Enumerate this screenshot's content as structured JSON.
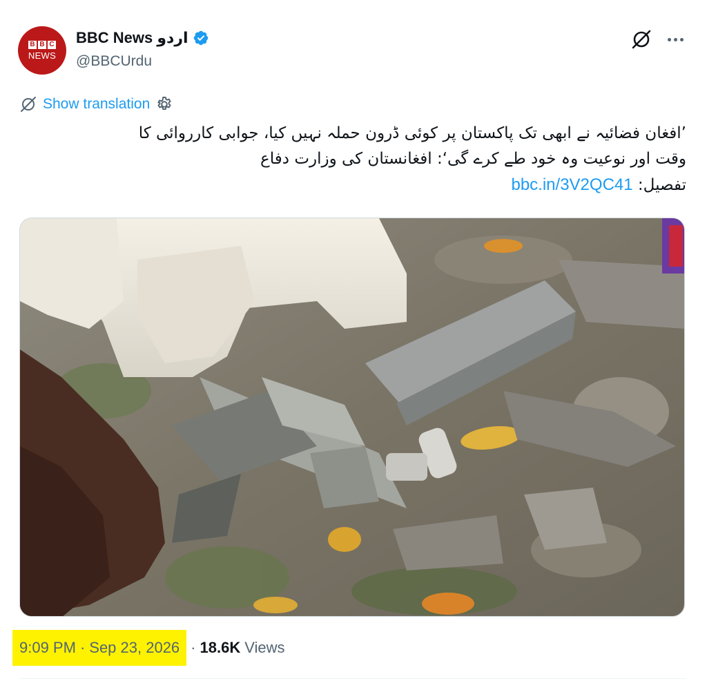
{
  "account": {
    "display_name": "BBC News اردو",
    "handle": "@BBCUrdu",
    "verified": true,
    "avatar": {
      "letters": [
        "B",
        "B",
        "C"
      ],
      "word": "NEWS",
      "color": "#bb1919"
    }
  },
  "actions": {
    "grok_icon": "grok-slash-icon",
    "more_icon": "more-dots-icon"
  },
  "translation": {
    "label": "Show translation"
  },
  "tweet": {
    "line1": "’افغان فضائیہ نے ابھی تک پاکستان پر کوئی ڈرون حملہ نہیں کیا، جوابی کارروائی کا",
    "line2": "وقت اور نوعیت وہ خود طے کرے گی‘: افغانستان کی وزارت دفاع",
    "line3_prefix": "تفصیل: ",
    "link": "bbc.in/3V2QC41"
  },
  "media": {
    "alt": "drone wreckage photo"
  },
  "meta": {
    "time": "9:09 PM",
    "separator": "·",
    "date": "Sep 23, 2026",
    "views_count": "18.6K",
    "views_label": "Views",
    "highlight_color": "#fff200"
  },
  "colors": {
    "link": "#1d9bf0",
    "secondary": "#536471",
    "text": "#0f1419",
    "verified": "#1d9bf0"
  }
}
